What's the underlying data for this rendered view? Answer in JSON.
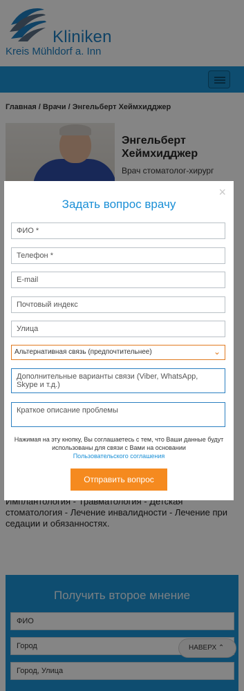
{
  "header": {
    "logo_line1": "Kliniken",
    "logo_line2": "Kreis Mühldorf a. Inn",
    "brand_color": "#1d7fc1",
    "nav_color": "#1b95d6"
  },
  "breadcrumb": "Главная / Врачи / Энгельберт Хеймхидджер",
  "doctor": {
    "name": "Энгельберт Хеймхидджер",
    "role": "Врач стоматолог-хирург"
  },
  "bio_text": "Имплантология - Травматология - Детская стоматология - Лечение инвалидности - Лечение при седации и обязанностях.",
  "modal": {
    "close_icon": "close-icon",
    "title": "Задать вопрос врачу",
    "fields": {
      "fio": "ФИО *",
      "phone": "Телефон *",
      "email": "E-mail",
      "postal": "Почтовый индекс",
      "street": "Улица",
      "alt_contact_select": "Альтернативная связь (предпочтительнее)",
      "extra_contacts": "Дополнительные варианты связи (Viber, WhatsApp, Skype и т.д.)",
      "problem": "Краткое описание проблемы"
    },
    "consent_text": "Нажимая на эту кнопку, Вы соглашаетесь с тем, что Ваши данные будут использованы для связи с Вами на основании",
    "consent_link": "Пользовательского соглашения",
    "submit_label": "Отправить вопрос",
    "accent_color": "#f58a1f"
  },
  "second_opinion": {
    "title": "Получить второе мнение",
    "fields": [
      "ФИО",
      "Город",
      "Город, Улица"
    ]
  },
  "back_to_top": "НАВЕРХ ⌃"
}
